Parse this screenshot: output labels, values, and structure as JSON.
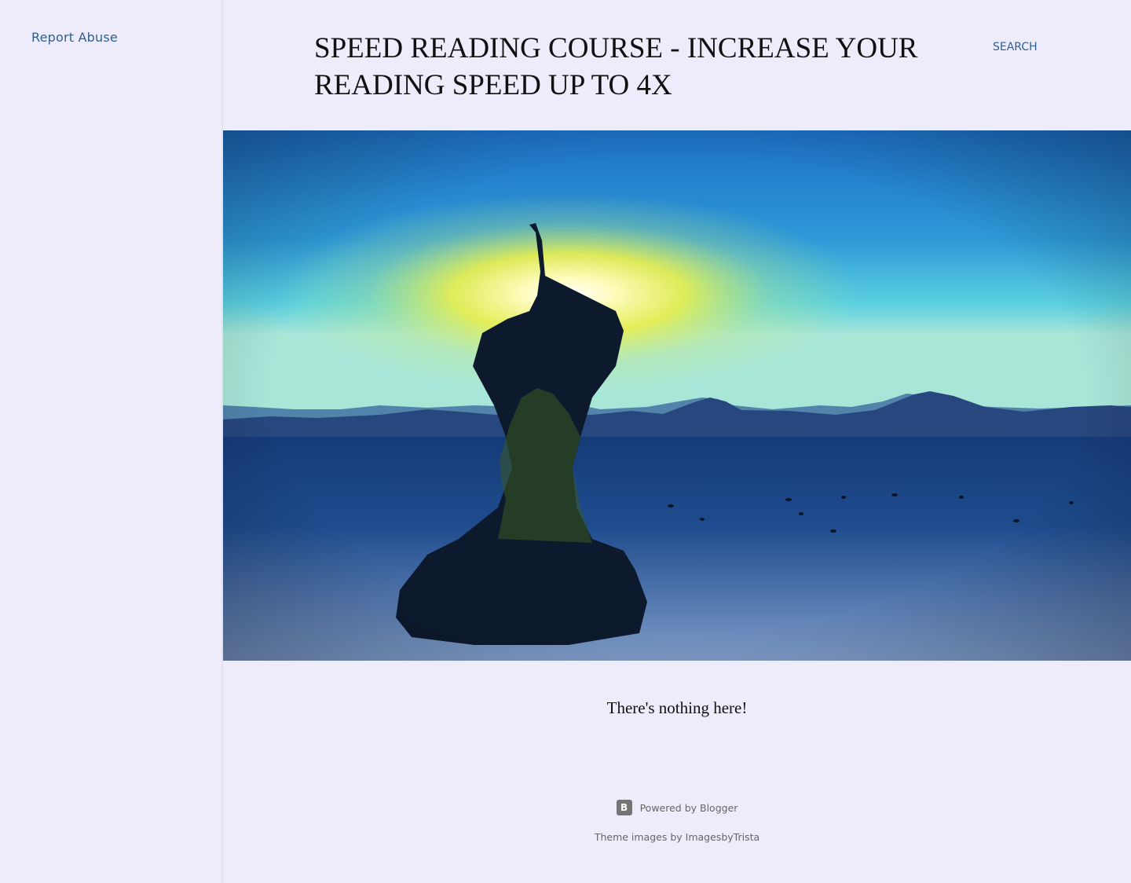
{
  "sidebar": {
    "report_abuse_label": "Report Abuse"
  },
  "header": {
    "title": "Speed Reading Course - Increase Your Reading Speed Up to 4x",
    "search_label": "SEARCH"
  },
  "main": {
    "empty_message": "There's nothing here!"
  },
  "footer": {
    "powered_by_label": "Powered by Blogger",
    "blogger_icon": "blogger-icon",
    "theme_credit": "Theme images by ImagesbyTrista"
  },
  "colors": {
    "page_background": "#eeecfa",
    "link": "#2f5f8f",
    "title_text": "#111111",
    "footer_text": "#666666"
  }
}
